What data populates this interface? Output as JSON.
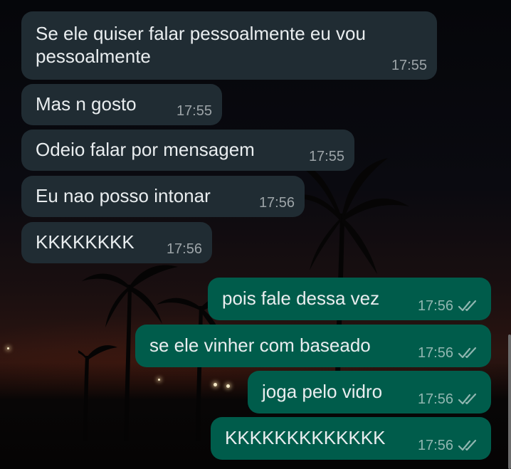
{
  "conversation": {
    "incoming": [
      {
        "text": "Se ele quiser falar pessoalmente eu vou\npessoalmente",
        "time": "17:55"
      },
      {
        "text": "Mas n gosto",
        "time": "17:55"
      },
      {
        "text": "Odeio falar por mensagem",
        "time": "17:55"
      },
      {
        "text": "Eu nao posso intonar",
        "time": "17:56"
      },
      {
        "text": "KKKKKKKK",
        "time": "17:56"
      }
    ],
    "outgoing": [
      {
        "text": "pois fale dessa vez",
        "time": "17:56",
        "status": "double-check-icon"
      },
      {
        "text": "se ele vinher com baseado",
        "time": "17:56",
        "status": "double-check-icon"
      },
      {
        "text": "joga pelo vidro",
        "time": "17:56",
        "status": "double-check-icon"
      },
      {
        "text": "KKKKKKKKKKKKK",
        "time": "17:56",
        "status": "double-check-icon"
      }
    ]
  },
  "colors": {
    "incoming_bubble": "#202c33",
    "outgoing_bubble": "#005c4b",
    "message_text": "#e9edef"
  }
}
